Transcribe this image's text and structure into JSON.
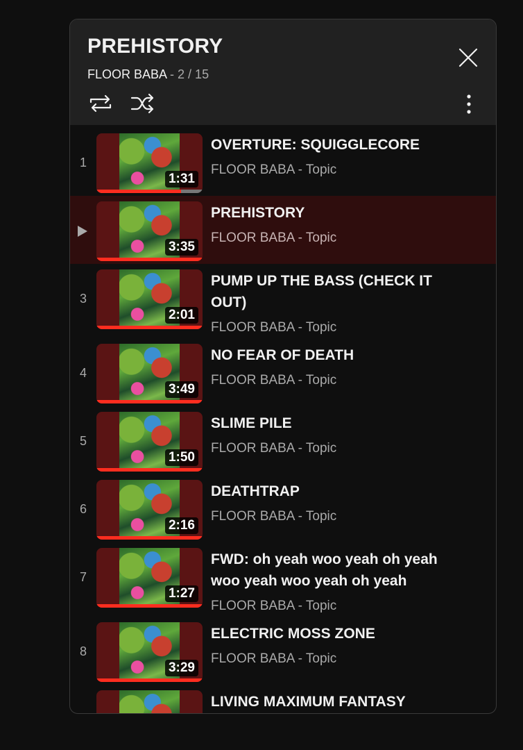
{
  "playlist": {
    "title": "PREHISTORY",
    "channel": "FLOOR BABA",
    "separator": " - ",
    "position": "2 / 15"
  },
  "controls": {
    "close_icon": "close-icon",
    "loop_icon": "loop-icon",
    "shuffle_icon": "shuffle-icon",
    "menu_icon": "more-vert-icon"
  },
  "colors": {
    "accent": "#ff2d1f",
    "active_row_bg": "#2f0d0d",
    "header_bg": "#212121"
  },
  "items": [
    {
      "index": "1",
      "title": "OVERTURE: SQUIGGLECORE",
      "channel": "FLOOR BABA - Topic",
      "duration": "1:31",
      "progress": 0.8
    },
    {
      "index": "▶",
      "title": "PREHISTORY",
      "channel": "FLOOR BABA - Topic",
      "duration": "3:35",
      "progress": 1.0,
      "active": true
    },
    {
      "index": "3",
      "title": "PUMP UP THE BASS (CHECK IT OUT)",
      "channel": "FLOOR BABA - Topic",
      "duration": "2:01",
      "progress": 1.0
    },
    {
      "index": "4",
      "title": "NO FEAR OF DEATH",
      "channel": "FLOOR BABA - Topic",
      "duration": "3:49",
      "progress": 1.0
    },
    {
      "index": "5",
      "title": "SLIME PILE",
      "channel": "FLOOR BABA - Topic",
      "duration": "1:50",
      "progress": 1.0
    },
    {
      "index": "6",
      "title": "DEATHTRAP",
      "channel": "FLOOR BABA - Topic",
      "duration": "2:16",
      "progress": 1.0
    },
    {
      "index": "7",
      "title": "FWD: oh yeah woo yeah oh yeah woo yeah woo yeah oh yeah oh…",
      "channel": "FLOOR BABA - Topic",
      "duration": "1:27",
      "progress": 1.0
    },
    {
      "index": "8",
      "title": "ELECTRIC MOSS ZONE",
      "channel": "FLOOR BABA - Topic",
      "duration": "3:29",
      "progress": 1.0
    },
    {
      "index": "",
      "title": "LIVING MAXIMUM FANTASY",
      "channel": "",
      "duration": "",
      "progress": 1.0
    }
  ]
}
